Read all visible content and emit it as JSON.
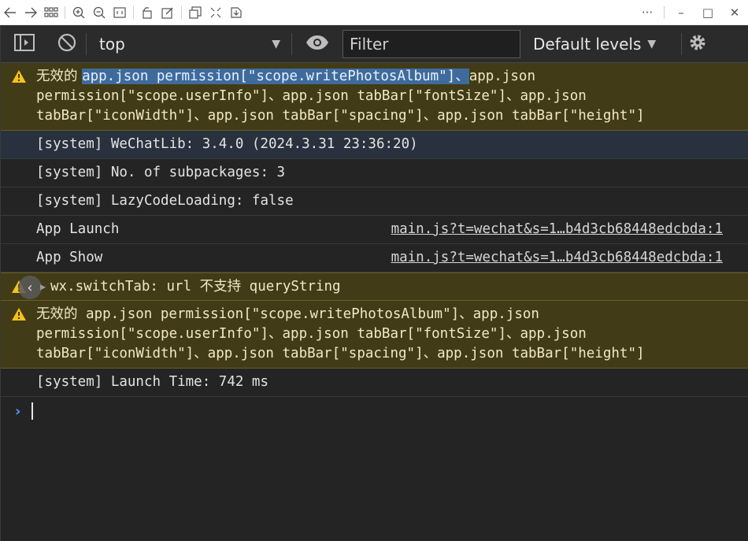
{
  "window_bar": {
    "left_icons": [
      "arrow-left-icon",
      "arrow-right-icon",
      "grid-icon",
      "zoom-in-icon",
      "zoom-out-icon",
      "fit-icon",
      "rotate-icon",
      "edit-icon",
      "copy-icon",
      "compress-icon",
      "save-icon"
    ],
    "right_icons": [
      "more-icon",
      "minimize-icon",
      "maximize-icon",
      "close-icon"
    ],
    "more_label": "···",
    "minimize_label": "–",
    "maximize_label": "□",
    "close_label": "✕"
  },
  "toolbar": {
    "context": "top",
    "filter_placeholder": "Filter",
    "levels": "Default levels"
  },
  "console": {
    "warn1": {
      "prefix": "无效的 ",
      "selected": "app.json permission[\"scope.writePhotosAlbum\"]、",
      "rest_line1": "app.json",
      "line2": "permission[\"scope.userInfo\"]、app.json tabBar[\"fontSize\"]、app.json",
      "line3": "tabBar[\"iconWidth\"]、app.json tabBar[\"spacing\"]、app.json tabBar[\"height\"]"
    },
    "rows": [
      {
        "text": "[system] WeChatLib: 3.4.0 (2024.3.31 23:36:20)"
      },
      {
        "text": "[system] No. of subpackages: 3"
      },
      {
        "text": "[system] LazyCodeLoading: false"
      },
      {
        "text": "App Launch",
        "link": "main.js?t=wechat&s=1…b4d3cb68448edcbda:1"
      },
      {
        "text": "App Show",
        "link": "main.js?t=wechat&s=1…b4d3cb68448edcbda:1"
      }
    ],
    "warn2": {
      "text": "wx.switchTab: url 不支持 queryString"
    },
    "warn3": {
      "line1": "无效的 app.json permission[\"scope.writePhotosAlbum\"]、app.json",
      "line2": "permission[\"scope.userInfo\"]、app.json tabBar[\"fontSize\"]、app.json",
      "line3": "tabBar[\"iconWidth\"]、app.json tabBar[\"spacing\"]、app.json tabBar[\"height\"]"
    },
    "launch_time": "[system] Launch Time: 742 ms",
    "prompt": "›"
  },
  "colors": {
    "warn_bg": "#413b18",
    "warn_icon": "#f7c21b",
    "selection": "#3e6b9c",
    "prompt": "#4a9eff"
  }
}
